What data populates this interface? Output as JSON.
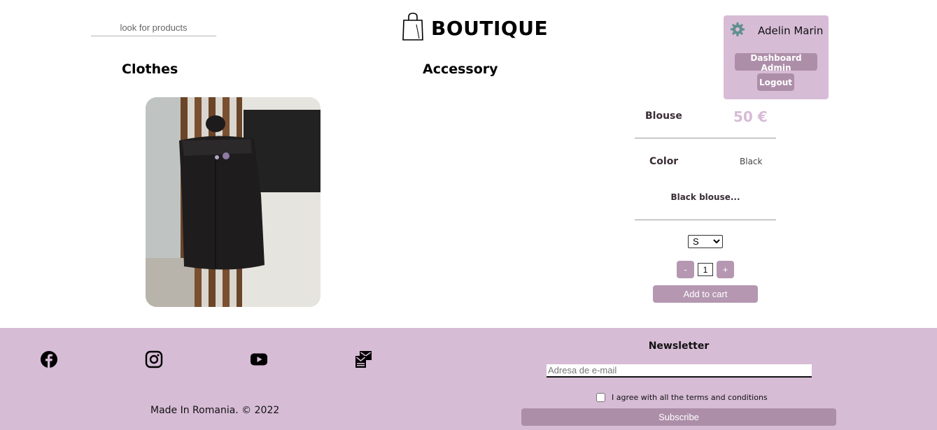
{
  "header": {
    "search_placeholder": "look for products",
    "brand_title": "BOUTIQUE",
    "nav": {
      "clothes": "Clothes",
      "accessory": "Accessory"
    }
  },
  "user": {
    "name": "Adelin Marin",
    "dashboard_label": "Dashboard Admin",
    "logout_label": "Logout"
  },
  "product": {
    "name": "Blouse",
    "price": "50 €",
    "color_label": "Color",
    "color_value": "Black",
    "description": "Black blouse...",
    "size_selected": "S",
    "quantity": "1",
    "minus_label": "-",
    "plus_label": "+",
    "add_to_cart_label": "Add to cart"
  },
  "footer": {
    "made_in": "Made In Romania. © 2022",
    "newsletter_title": "Newsletter",
    "email_placeholder": "Adresa de e-mail",
    "terms_label": "I agree with all the terms and conditions",
    "subscribe_label": "Subscribe",
    "social_icons": [
      "facebook-icon",
      "instagram-icon",
      "youtube-icon",
      "contact-mail-icon"
    ]
  },
  "colors": {
    "accent": "#d7bcd6",
    "button": "#ad8ea9",
    "price": "#d7bcd6"
  }
}
